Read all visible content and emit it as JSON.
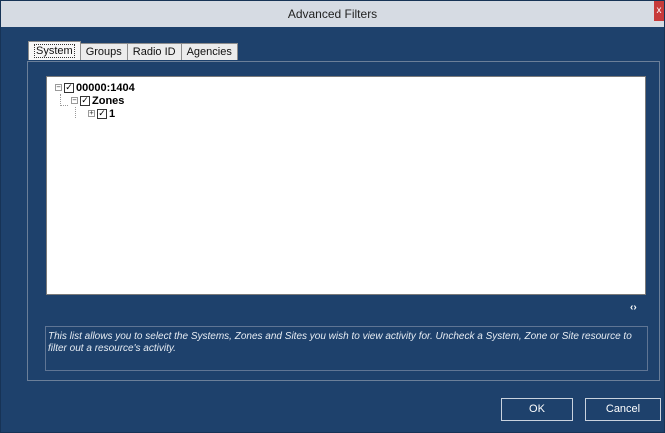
{
  "window": {
    "title": "Advanced Filters",
    "close_glyph": "x"
  },
  "tabs": [
    {
      "label": "System",
      "active": true
    },
    {
      "label": "Groups",
      "active": false
    },
    {
      "label": "Radio ID",
      "active": false
    },
    {
      "label": "Agencies",
      "active": false
    }
  ],
  "tree": {
    "system": {
      "label": "00000:1404",
      "checked": true,
      "expander": "−"
    },
    "zones": {
      "label": "Zones",
      "checked": true,
      "expander": "−"
    },
    "zone1": {
      "label": "1",
      "checked": true,
      "expander": "+"
    }
  },
  "refresh_glyph": "‹›",
  "info_text": "This list allows you to select the Systems, Zones and Sites you wish to view activity for.  Uncheck a System, Zone or Site resource to filter out a resource's activity.",
  "buttons": {
    "ok": "OK",
    "cancel": "Cancel"
  }
}
